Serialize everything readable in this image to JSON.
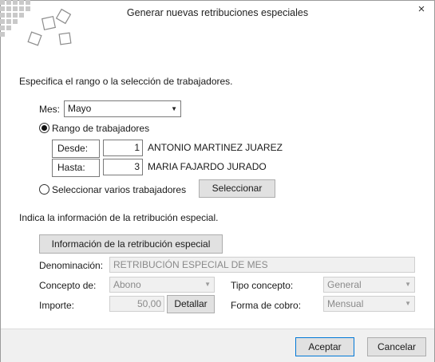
{
  "dialog": {
    "title": "Generar nuevas retribuciones especiales",
    "close_icon": "×"
  },
  "range_section": {
    "heading": "Especifica el rango o la selección de trabajadores.",
    "mes_label": "Mes:",
    "mes_value": "Mayo",
    "radio_range_label": "Rango de trabajadores",
    "radio_range_selected": true,
    "desde_label": "Desde:",
    "desde_value": "1",
    "desde_name": "ANTONIO MARTINEZ JUAREZ",
    "hasta_label": "Hasta:",
    "hasta_value": "3",
    "hasta_name": "MARIA FAJARDO JURADO",
    "radio_multi_label": "Seleccionar varios trabajadores",
    "radio_multi_selected": false,
    "select_button": "Seleccionar"
  },
  "info_section": {
    "heading": "Indica la información de la retribución especial.",
    "info_button": "Información de la retribución especial",
    "denominacion_label": "Denominación:",
    "denominacion_value": "RETRIBUCIÓN ESPECIAL DE MES",
    "concepto_label": "Concepto de:",
    "concepto_value": "Abono",
    "tipo_label": "Tipo concepto:",
    "tipo_value": "General",
    "importe_label": "Importe:",
    "importe_value": "50,00",
    "detallar_button": "Detallar",
    "forma_label": "Forma de cobro:",
    "forma_value": "Mensual"
  },
  "footer": {
    "accept_button": "Aceptar",
    "cancel_button": "Cancelar"
  },
  "icons": {
    "logo": "scattered-squares-logo-icon",
    "dropdown": "chevron-down-icon",
    "close": "close-icon"
  },
  "colors": {
    "accent": "#0078d7",
    "footer_bg": "#f0f0f0",
    "disabled_bg": "#f0f0f0"
  }
}
